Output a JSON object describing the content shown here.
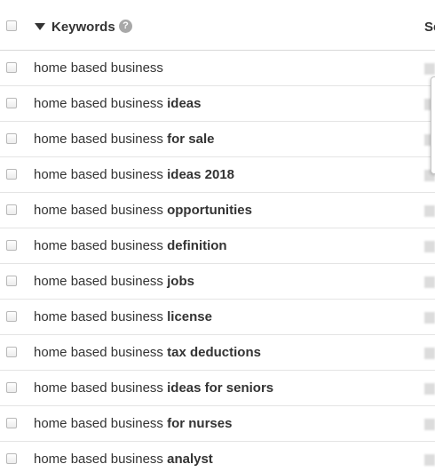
{
  "header": {
    "keywords_label": "Keywords",
    "help_symbol": "?",
    "second_column_label": "Se"
  },
  "rows": [
    {
      "base": "home based business",
      "suffix": ""
    },
    {
      "base": "home based business",
      "suffix": "ideas"
    },
    {
      "base": "home based business",
      "suffix": "for sale"
    },
    {
      "base": "home based business",
      "suffix": "ideas 2018"
    },
    {
      "base": "home based business",
      "suffix": "opportunities"
    },
    {
      "base": "home based business",
      "suffix": "definition"
    },
    {
      "base": "home based business",
      "suffix": "jobs"
    },
    {
      "base": "home based business",
      "suffix": "license"
    },
    {
      "base": "home based business",
      "suffix": "tax deductions"
    },
    {
      "base": "home based business",
      "suffix": "ideas for seniors"
    },
    {
      "base": "home based business",
      "suffix": "for nurses"
    },
    {
      "base": "home based business",
      "suffix": "analyst"
    }
  ],
  "icons": {
    "sort": "triangle-down-icon",
    "help": "question-circle-icon"
  }
}
